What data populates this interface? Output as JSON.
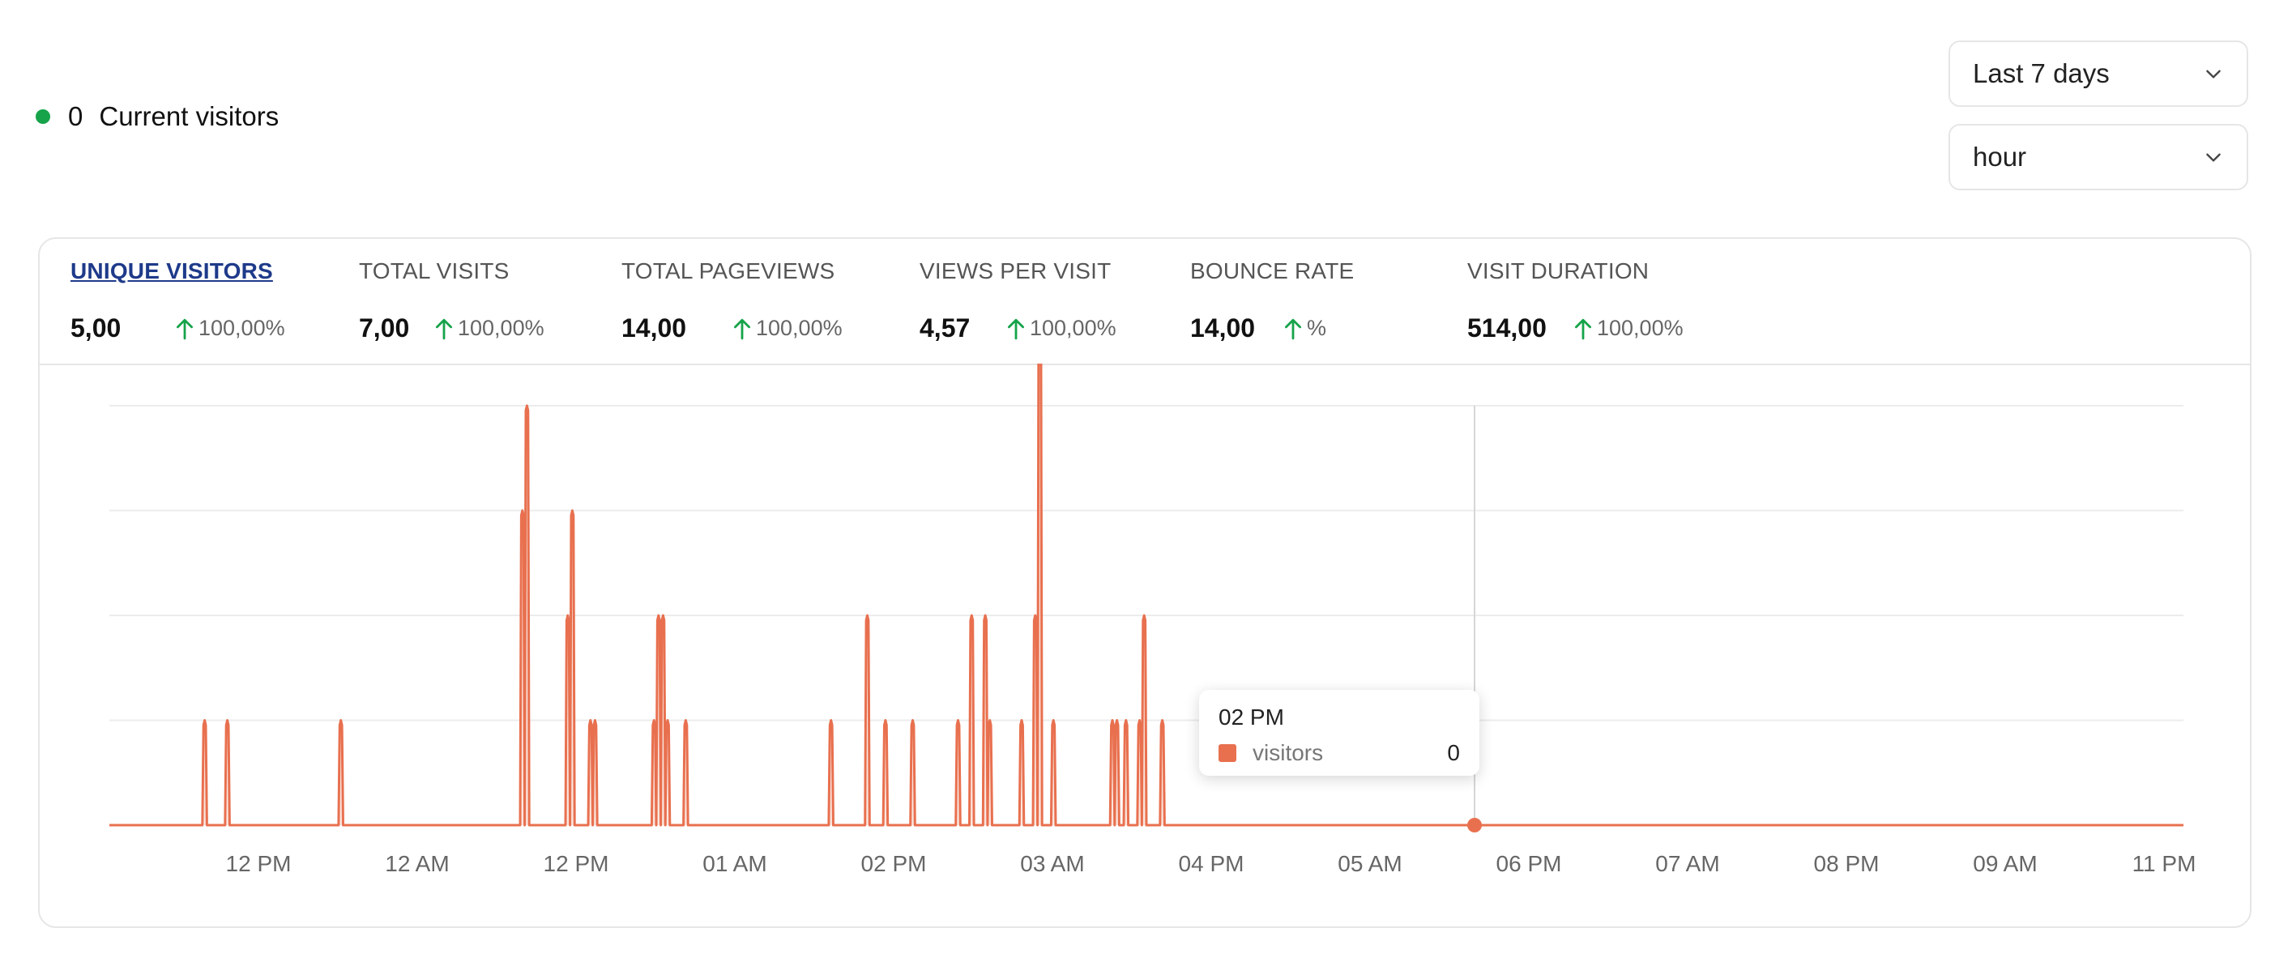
{
  "current_visitors": {
    "count": "0",
    "label": "Current visitors",
    "status_color": "#16a34a"
  },
  "filters": {
    "range": {
      "value": "Last 7 days",
      "icon": "chevron-down-icon"
    },
    "granularity": {
      "value": "hour",
      "icon": "chevron-down-icon"
    }
  },
  "metrics": [
    {
      "label": "UNIQUE VISITORS",
      "value": "5,00",
      "change": "100,00%",
      "active": true
    },
    {
      "label": "TOTAL VISITS",
      "value": "7,00",
      "change": "100,00%"
    },
    {
      "label": "TOTAL PAGEVIEWS",
      "value": "14,00",
      "change": "100,00%"
    },
    {
      "label": "VIEWS PER VISIT",
      "value": "4,57",
      "change": "100,00%"
    },
    {
      "label": "BOUNCE RATE",
      "value": "14,00",
      "change": "%"
    },
    {
      "label": "VISIT DURATION",
      "value": "514,00",
      "change": "100,00%"
    }
  ],
  "colors": {
    "series": "#e8704f",
    "series_fill": "#fbe5dd",
    "up_arrow": "#16a34a",
    "grid": "#ececec"
  },
  "tooltip": {
    "title": "02 PM",
    "series": "visitors",
    "value": "0"
  },
  "chart_data": {
    "type": "area",
    "x_tick_labels": [
      "12 PM",
      "12 AM",
      "12 PM",
      "01 AM",
      "02 PM",
      "03 AM",
      "04 PM",
      "05 AM",
      "06 PM",
      "07 AM",
      "08 PM",
      "09 AM",
      "11 PM"
    ],
    "ylim": [
      0,
      4
    ],
    "grid": "horizontal",
    "series": [
      {
        "values": [
          0,
          0,
          0,
          0,
          0,
          0,
          0,
          0,
          0,
          0,
          0,
          0,
          0,
          0,
          0,
          0,
          0,
          0,
          0,
          0,
          0,
          1,
          0,
          0,
          0,
          0,
          1,
          0,
          0,
          0,
          0,
          0,
          0,
          0,
          0,
          0,
          0,
          0,
          0,
          0,
          0,
          0,
          0,
          0,
          0,
          0,
          0,
          0,
          0,
          0,
          0,
          1,
          0,
          0,
          0,
          0,
          0,
          0,
          0,
          0,
          0,
          0,
          0,
          0,
          0,
          0,
          0,
          0,
          0,
          0,
          0,
          0,
          0,
          0,
          0,
          0,
          0,
          0,
          0,
          0,
          0,
          0,
          0,
          0,
          0,
          0,
          0,
          0,
          0,
          0,
          0,
          3,
          4,
          0,
          0,
          0,
          0,
          0,
          0,
          0,
          0,
          2,
          3,
          0,
          0,
          0,
          1,
          1,
          0,
          0,
          0,
          0,
          0,
          0,
          0,
          0,
          0,
          0,
          0,
          0,
          1,
          2,
          2,
          1,
          0,
          0,
          0,
          1,
          0,
          0,
          0,
          0,
          0,
          0,
          0,
          0,
          0,
          0,
          0,
          0,
          0,
          0,
          0,
          0,
          0,
          0,
          0,
          0,
          0,
          0,
          0,
          0,
          0,
          0,
          0,
          0,
          0,
          0,
          0,
          1,
          0,
          0,
          0,
          0,
          0,
          0,
          0,
          2,
          0,
          0,
          0,
          1,
          0,
          0,
          0,
          0,
          0,
          1,
          0,
          0,
          0,
          0,
          0,
          0,
          0,
          0,
          0,
          1,
          0,
          0,
          2,
          0,
          0,
          2,
          1,
          0,
          0,
          0,
          0,
          0,
          0,
          1,
          0,
          0,
          2,
          5,
          0,
          0,
          1,
          0,
          0,
          0,
          0,
          0,
          0,
          0,
          0,
          0,
          0,
          0,
          0,
          1,
          1,
          0,
          1,
          0,
          0,
          1,
          2,
          0,
          0,
          0,
          1,
          0,
          0,
          0,
          0,
          0,
          0,
          0,
          0,
          0,
          0,
          0,
          0,
          0,
          0,
          0,
          0,
          0,
          0,
          0,
          0,
          0,
          0,
          0,
          0,
          0,
          0,
          0,
          0,
          0,
          0,
          0,
          0,
          0,
          0,
          0,
          0,
          0,
          0,
          0,
          0,
          0,
          0,
          0,
          0,
          0,
          0,
          0,
          0,
          0,
          0,
          0,
          0,
          0,
          0,
          0,
          0,
          0,
          0,
          0,
          0,
          0,
          0,
          0,
          0,
          0,
          0,
          0,
          0,
          0,
          0,
          0,
          0,
          0,
          0,
          0,
          0,
          0,
          0,
          0,
          0,
          0,
          0,
          0,
          0,
          0,
          0,
          0,
          0,
          0,
          0,
          0,
          0,
          0,
          0,
          0,
          0,
          0,
          0,
          0,
          0,
          0,
          0,
          0,
          0,
          0,
          0,
          0,
          0,
          0,
          0,
          0,
          0,
          0,
          0,
          0,
          0,
          0,
          0,
          0,
          0,
          0,
          0,
          0,
          0,
          0,
          0,
          0,
          0,
          0,
          0,
          0,
          0,
          0,
          0,
          0,
          0,
          0,
          0,
          0,
          0,
          0,
          0,
          0,
          0,
          0,
          0,
          0,
          0,
          0,
          0,
          0,
          0,
          0,
          0,
          0,
          0,
          0,
          0,
          0,
          0,
          0,
          0,
          0,
          0,
          0,
          0,
          0,
          0,
          0,
          0,
          0,
          0,
          0,
          0,
          0,
          0,
          0,
          0,
          0,
          0,
          0,
          0,
          0,
          0,
          0,
          0,
          0,
          0,
          0,
          0,
          0,
          0,
          0,
          0,
          0,
          0,
          0,
          0,
          0,
          0,
          0,
          0,
          0,
          0,
          0,
          0,
          0,
          0,
          0,
          0,
          0,
          0,
          0,
          0,
          0,
          0,
          0,
          0,
          0,
          0,
          0,
          0,
          0,
          0,
          0
        ]
      }
    ],
    "highlight": {
      "label": "02 PM",
      "value": 0
    }
  }
}
